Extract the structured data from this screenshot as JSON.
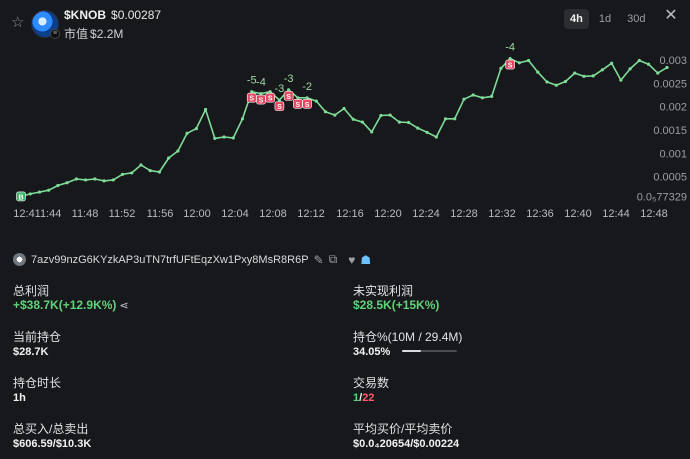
{
  "header": {
    "star_icon": "star-icon",
    "ticker": "$KNOB",
    "price": "$0.00287",
    "mcap_label": "市值",
    "mcap_value": "$2.2M",
    "tabs": [
      {
        "label": "4h",
        "active": true
      },
      {
        "label": "1d",
        "active": false
      },
      {
        "label": "30d",
        "active": false
      }
    ],
    "close_icon": "close-icon"
  },
  "chart_data": {
    "type": "line",
    "color": "#7fdc98",
    "x_ticks": [
      "12:4",
      "11:44",
      "11:48",
      "11:52",
      "11:56",
      "12:00",
      "12:04",
      "12:08",
      "12:12",
      "12:16",
      "12:20",
      "12:24",
      "12:28",
      "12:32",
      "12:36",
      "12:40",
      "12:44",
      "12:48"
    ],
    "y_ticks": [
      "0.003",
      "0.0025",
      "0.002",
      "0.0015",
      "0.001",
      "0.0005",
      "0.0₅77329"
    ],
    "ylim": [
      0,
      0.0033
    ],
    "values": [
      7.7e-05,
      0.00013,
      0.00017,
      0.00021,
      0.00031,
      0.00037,
      0.00045,
      0.00043,
      0.00045,
      0.00041,
      0.00043,
      0.00055,
      0.00058,
      0.00075,
      0.00063,
      0.0006,
      0.0009,
      0.00105,
      0.00143,
      0.00153,
      0.00194,
      0.00132,
      0.00135,
      0.00133,
      0.00174,
      0.00232,
      0.00228,
      0.00232,
      0.00214,
      0.00236,
      0.00219,
      0.00219,
      0.00212,
      0.00189,
      0.00182,
      0.00196,
      0.00173,
      0.00167,
      0.00146,
      0.00181,
      0.00182,
      0.00167,
      0.00166,
      0.00154,
      0.00145,
      0.00135,
      0.00174,
      0.00174,
      0.00216,
      0.00225,
      0.00219,
      0.00222,
      0.00282,
      0.00303,
      0.00294,
      0.00299,
      0.00274,
      0.00253,
      0.00246,
      0.00254,
      0.00272,
      0.00265,
      0.00266,
      0.00279,
      0.00293,
      0.00257,
      0.00281,
      0.00299,
      0.00291,
      0.00272,
      0.00284
    ],
    "markers": [
      {
        "i": 0,
        "type": "B"
      },
      {
        "i": 25,
        "type": "S"
      },
      {
        "i": 26,
        "type": "S"
      },
      {
        "i": 27,
        "type": "S"
      },
      {
        "i": 28,
        "type": "S"
      },
      {
        "i": 29,
        "type": "S"
      },
      {
        "i": 30,
        "type": "S"
      },
      {
        "i": 31,
        "type": "S"
      },
      {
        "i": 53,
        "type": "S"
      }
    ],
    "trade_labels": [
      {
        "text": "-5",
        "i": 25
      },
      {
        "text": "-4",
        "i": 26
      },
      {
        "text": "-3",
        "i": 28
      },
      {
        "text": "-3",
        "i": 29
      },
      {
        "text": "-2",
        "i": 31
      },
      {
        "text": "-4",
        "i": 53
      }
    ]
  },
  "wallet": {
    "avatar": "wallet-avatar",
    "address": "7azv99nzG6KYzkAP3uTN7trfUFtEqzXw1Pxy8MsR8R6P",
    "edit_icon": "pencil-icon",
    "copy_icon": "copy-icon",
    "heart_icon": "heart-icon",
    "ghost_icon": "ghost-icon"
  },
  "stats": {
    "total_profit": {
      "label": "总利润",
      "value": "+$38.7K(+12.9K%)",
      "share_icon": "share-icon"
    },
    "unrealized": {
      "label": "未实现利润",
      "value": "$28.5K(+15K%)"
    },
    "holding": {
      "label": "当前持仓",
      "value": "$28.7K"
    },
    "holding_pct": {
      "label": "持仓%(10M / 29.4M)",
      "value": "34.05%",
      "fraction": 0.3405
    },
    "hold_time": {
      "label": "持仓时长",
      "value": "1h"
    },
    "trades": {
      "label": "交易数",
      "buys": "1",
      "sep": "/",
      "sells": "22"
    },
    "buy_sell_total": {
      "label": "总买入/总卖出",
      "value": "$606.59/$10.3K"
    },
    "avg_price": {
      "label": "平均买价/平均卖价",
      "value": "$0.0₄20654/$0.00224"
    }
  }
}
